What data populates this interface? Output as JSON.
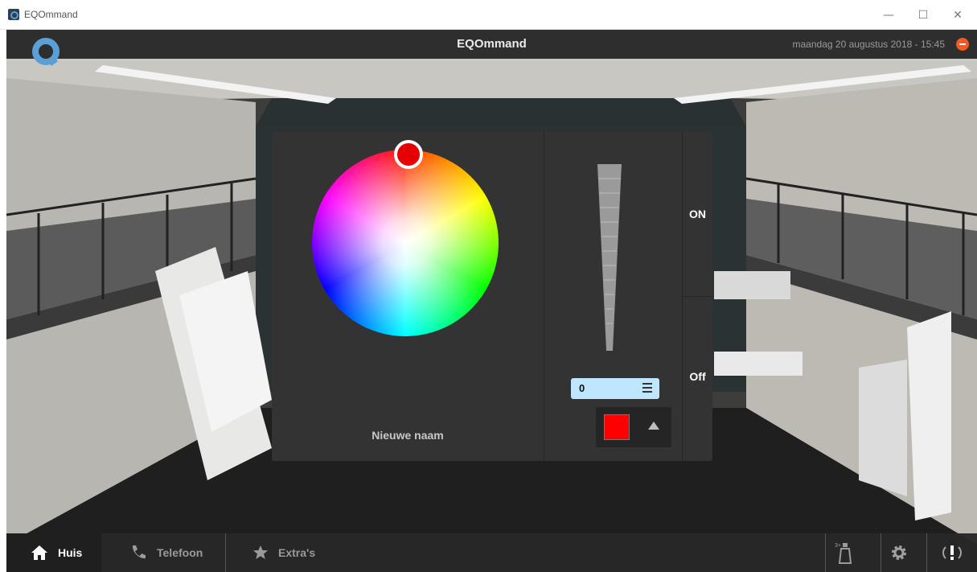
{
  "window": {
    "title": "EQOmmand",
    "minimize": "—",
    "maximize": "☐",
    "close": "✕"
  },
  "header": {
    "title": "EQOmmand",
    "datetime": "maandag 20 augustus 2018 - 15:45"
  },
  "panel": {
    "device_name": "Nieuwe naam",
    "dim_value": "0",
    "on_label": "ON",
    "off_label": "Off",
    "selected_color": "#ff0000"
  },
  "bottom_nav": {
    "tabs": [
      {
        "label": "Huis",
        "icon": "home-icon",
        "active": true
      },
      {
        "label": "Telefoon",
        "icon": "phone-icon",
        "active": false
      },
      {
        "label": "Extra's",
        "icon": "star-icon",
        "active": false
      }
    ],
    "right_buttons": [
      {
        "icon": "cleaning-spray-icon",
        "badge": "3+"
      },
      {
        "icon": "gear-icon"
      },
      {
        "icon": "alarm-icon"
      }
    ]
  },
  "colors": {
    "accent": "#f15a22",
    "logo": "#5aa0d6",
    "slider_box": "#bfe6ff"
  }
}
